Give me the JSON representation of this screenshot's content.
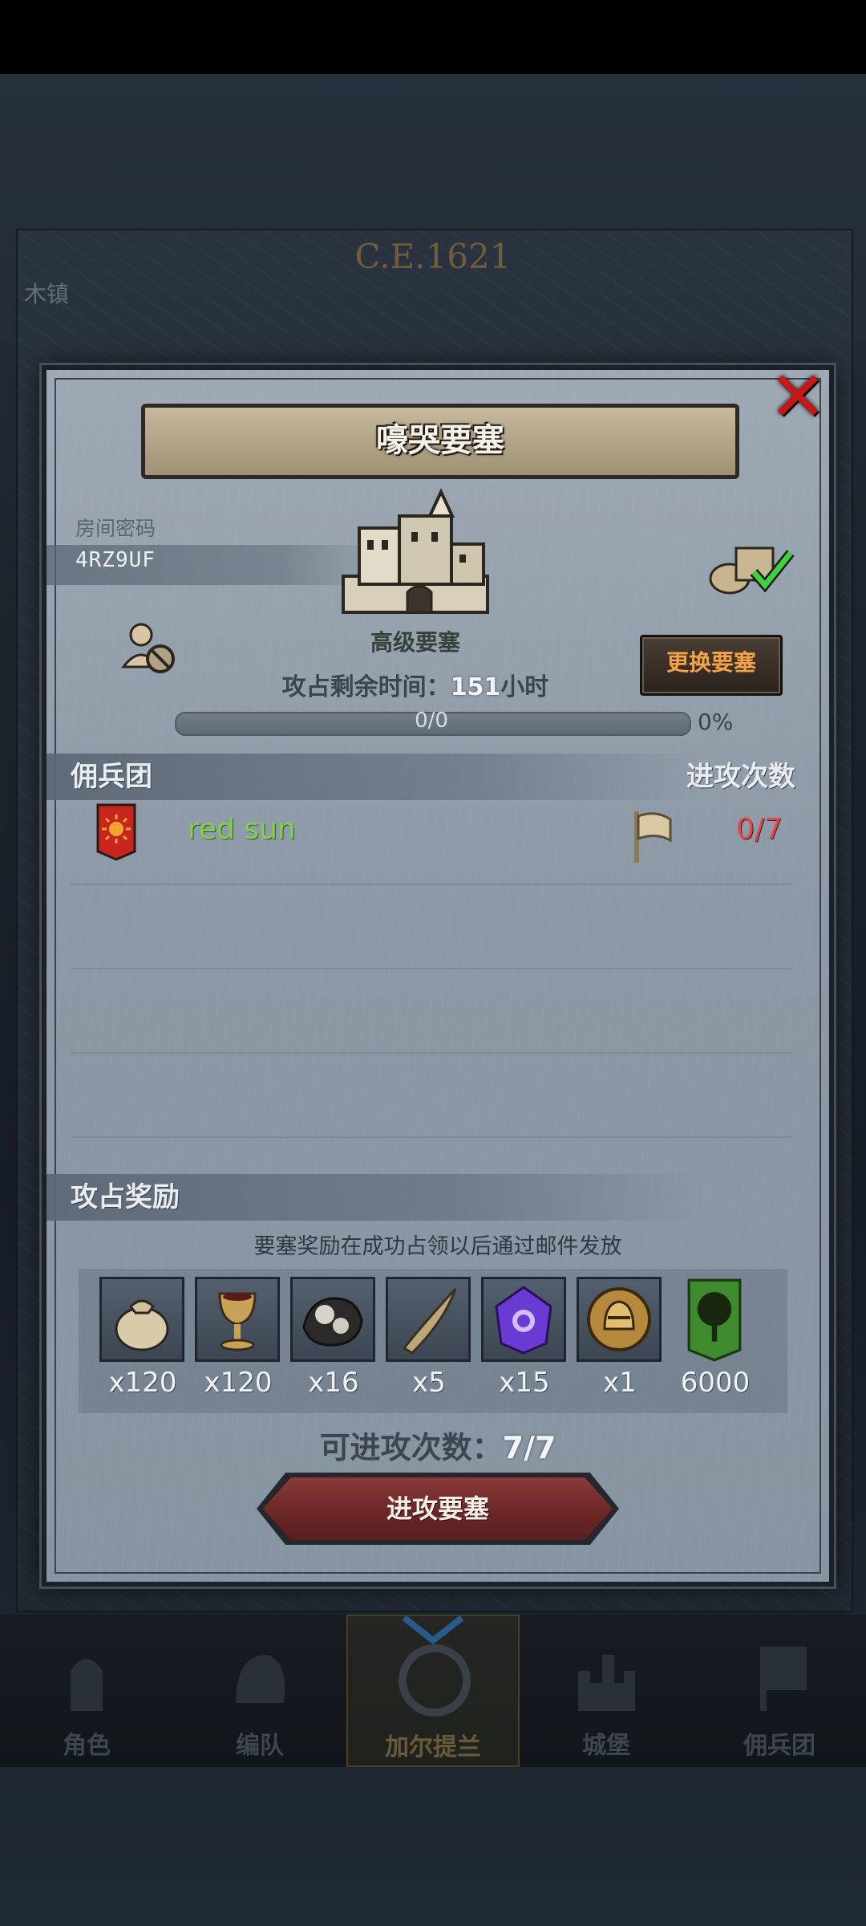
{
  "background": {
    "date": "C.E.1621",
    "town_label": "木镇"
  },
  "dialog": {
    "title": "嚎哭要塞",
    "room": {
      "label": "房间密码",
      "code": "4RZ9UF"
    },
    "fortress_type": "高级要塞",
    "change_button": "更换要塞",
    "timer": {
      "label": "攻占剩余时间：",
      "value": "151",
      "unit": "小时"
    },
    "progress": {
      "text": "0/0",
      "percent_label": "0%",
      "fill": 0
    },
    "mercenary_section": {
      "title": "佣兵团",
      "right_title": "进攻次数"
    },
    "mercenaries": [
      {
        "name": "red sun",
        "attacks": "0/7"
      }
    ],
    "reward_section": {
      "title": "攻占奖励",
      "note": "要塞奖励在成功占领以后通过邮件发放"
    },
    "rewards": [
      {
        "icon": "sack-icon",
        "qty": "x120"
      },
      {
        "icon": "goblet-icon",
        "qty": "x120"
      },
      {
        "icon": "ore-icon",
        "qty": "x16"
      },
      {
        "icon": "horn-icon",
        "qty": "x5"
      },
      {
        "icon": "crystal-icon",
        "qty": "x15"
      },
      {
        "icon": "helmet-coin-icon",
        "qty": "x1"
      },
      {
        "icon": "tree-banner-icon",
        "qty": "6000"
      }
    ],
    "attacks_left": {
      "label": "可进攻次数：",
      "value": "7/7"
    },
    "attack_button": "进攻要塞"
  },
  "bottom_nav": [
    {
      "label": "角色"
    },
    {
      "label": "编队"
    },
    {
      "label": "加尔提兰"
    },
    {
      "label": "城堡"
    },
    {
      "label": "佣兵团"
    }
  ],
  "colors": {
    "accent_orange": "#f3a24a",
    "merc_green": "#7fd24a",
    "count_red": "#e2484a",
    "close_red": "#c6181b"
  }
}
